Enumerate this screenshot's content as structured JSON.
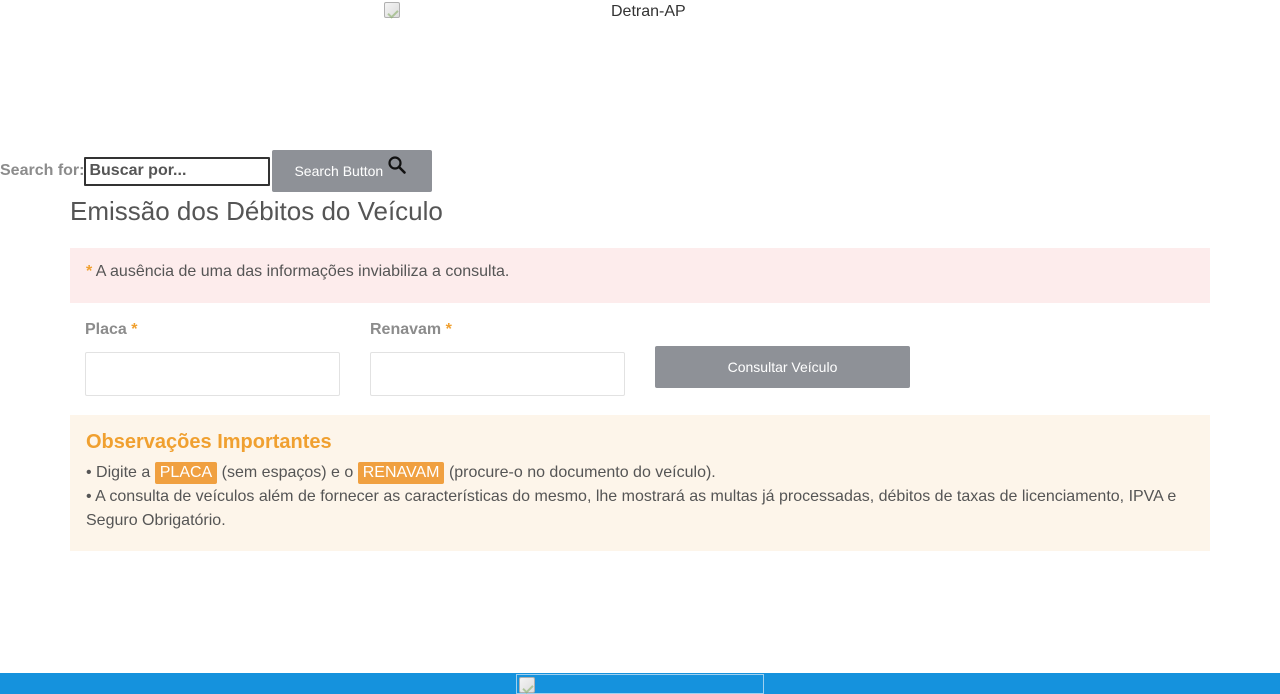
{
  "header": {
    "logo_alt": "Detran-AP"
  },
  "search": {
    "label": "Search for:",
    "placeholder": "Buscar por...",
    "button_label": "Search Button",
    "icon": "search-icon"
  },
  "main": {
    "title": "Emissão dos Débitos do Veículo",
    "alert": {
      "marker": "*",
      "text": "A ausência de uma das informações inviabiliza a consulta."
    },
    "form": {
      "placa_label": "Placa",
      "renavam_label": "Renavam",
      "required_marker": "*",
      "placa_value": "",
      "renavam_value": "",
      "submit_label": "Consultar Veículo"
    },
    "notes": {
      "title": "Observações Importantes",
      "line1_prefix": "• Digite a",
      "line1_tag1": "PLACA",
      "line1_middle": "(sem espaços) e o",
      "line1_tag2": "RENAVAM",
      "line1_suffix": "(procure-o no documento do veículo).",
      "line2": "• A consulta de veículos além de fornecer as características do mesmo, lhe mostrará as multas já processadas, débitos de taxas de licenciamento, IPVA e Seguro Obrigatório."
    }
  },
  "colors": {
    "accent": "#f0a030",
    "button": "#8e9197",
    "alert_bg": "#fdecec",
    "notes_bg": "#fdf5ea",
    "footer": "#1592dd"
  }
}
